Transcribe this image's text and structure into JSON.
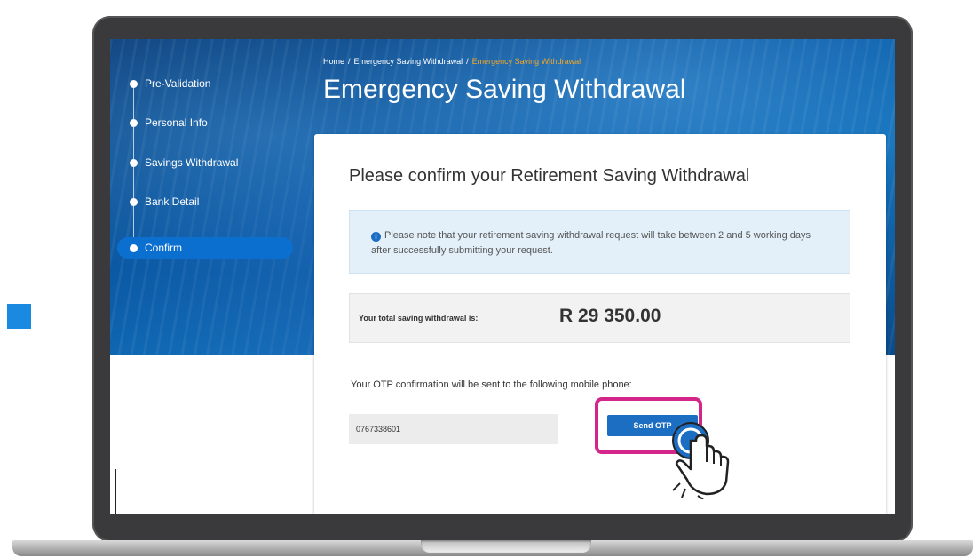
{
  "sidebar": {
    "steps": [
      {
        "label": "Pre-Validation"
      },
      {
        "label": "Personal Info"
      },
      {
        "label": "Savings Withdrawal"
      },
      {
        "label": "Bank Detail"
      },
      {
        "label": "Confirm"
      }
    ],
    "active_step": "Confirm"
  },
  "breadcrumb": {
    "home": "Home",
    "separator": "/",
    "parent": "Emergency Saving Withdrawal",
    "current": "Emergency Saving Withdrawal"
  },
  "page": {
    "title": "Emergency Saving Withdrawal"
  },
  "card": {
    "title": "Please confirm your Retirement Saving Withdrawal",
    "notice": "Please note that your retirement saving withdrawal request will take between 2 and 5 working days after successfully submitting your request.",
    "total_label": "Your total saving withdrawal is:",
    "total_value": "R 29 350.00",
    "otp_label": "Your OTP confirmation will be sent to the following mobile phone:",
    "phone_value": "0767338601",
    "send_otp_label": "Send OTP"
  },
  "colors": {
    "primary": "#1b6ec2",
    "highlight": "#d4268a",
    "breadcrumb_current": "#f5a623",
    "accent_square": "#1a8ae0"
  },
  "icons": {
    "notice": "info-icon",
    "cursor": "hand-pointer-icon"
  }
}
